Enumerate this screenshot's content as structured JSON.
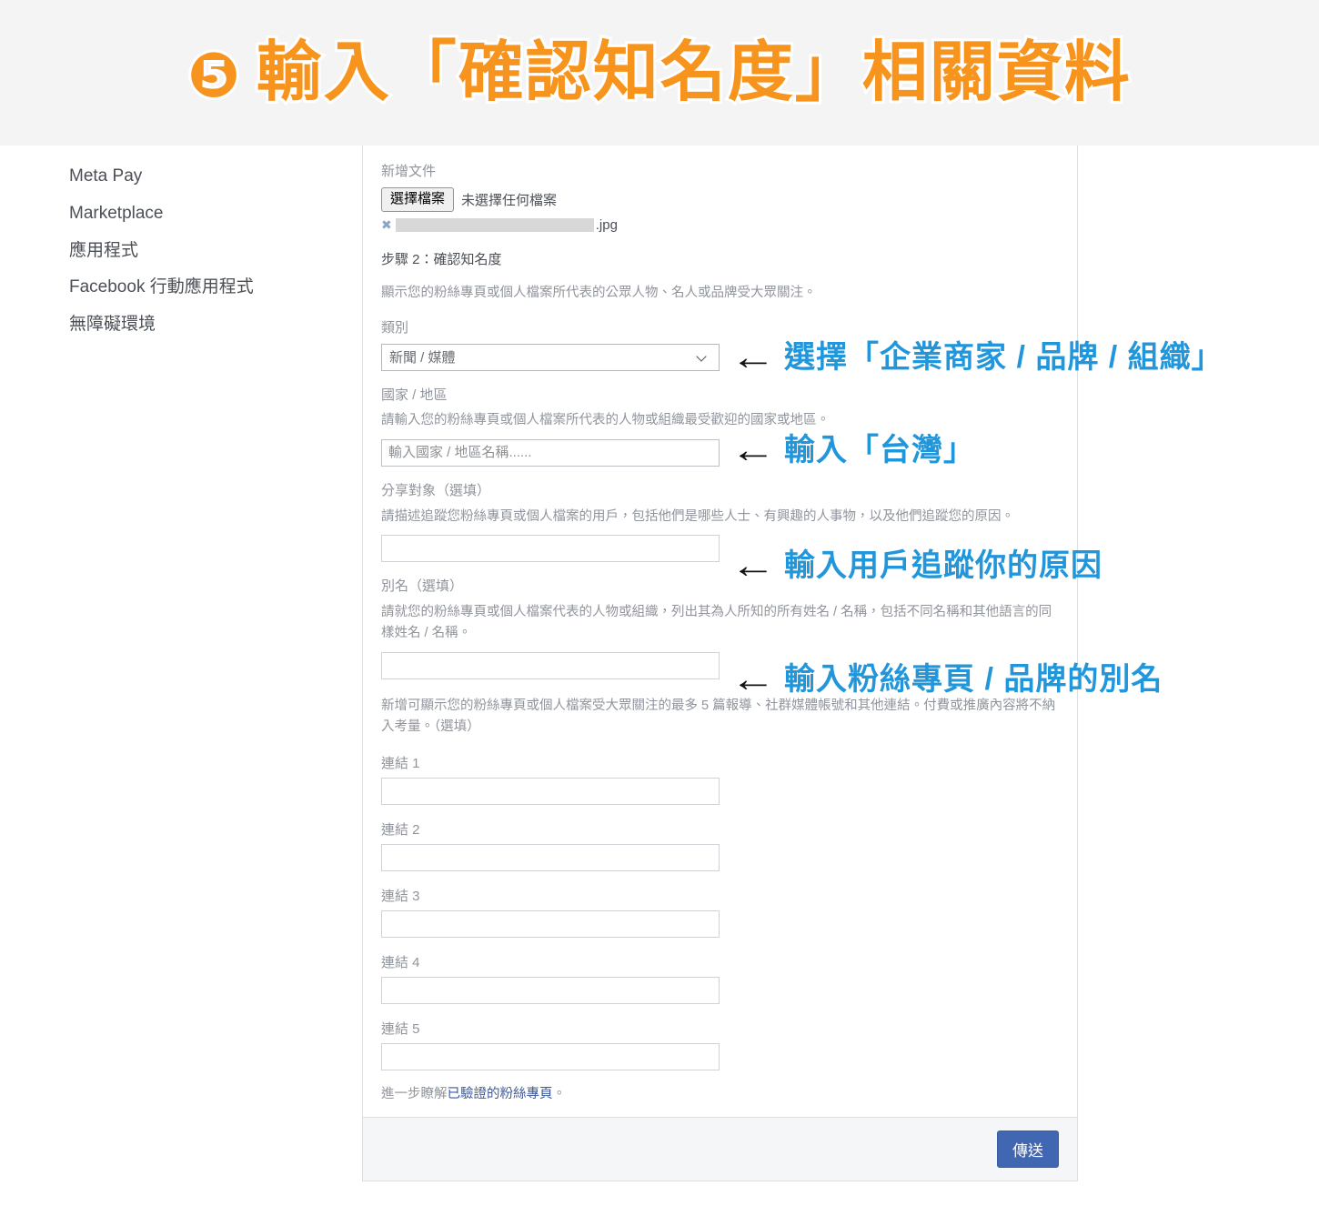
{
  "banner": {
    "step_badge": "❺",
    "title": "輸入「確認知名度」相關資料",
    "color": "#f7941e"
  },
  "sidebar": {
    "items": [
      {
        "label": "Meta Pay"
      },
      {
        "label": "Marketplace"
      },
      {
        "label": "應用程式"
      },
      {
        "label": "Facebook 行動應用程式"
      },
      {
        "label": "無障礙環境"
      }
    ]
  },
  "form": {
    "add_document_label": "新增文件",
    "file_button_label": "選擇檔案",
    "file_status_text": "未選擇任何檔案",
    "attachment_remove_icon": "✖",
    "attachment_extension": ".jpg",
    "step_title": "步驟 2：確認知名度",
    "step_description": "顯示您的粉絲專頁或個人檔案所代表的公眾人物、名人或品牌受大眾關注。",
    "category": {
      "label": "類別",
      "selected_value": "新聞 / 媒體"
    },
    "country": {
      "label": "國家 / 地區",
      "description": "請輸入您的粉絲專頁或個人檔案所代表的人物或組織最受歡迎的國家或地區。",
      "placeholder": "輸入國家 / 地區名稱......",
      "value": ""
    },
    "audience": {
      "label": "分享對象（選填）",
      "description": "請描述追蹤您粉絲專頁或個人檔案的用戶，包括他們是哪些人士、有興趣的人事物，以及他們追蹤您的原因。",
      "value": ""
    },
    "alias": {
      "label": "別名（選填）",
      "description": "請就您的粉絲專頁或個人檔案代表的人物或組織，列出其為人所知的所有姓名 / 名稱，包括不同名稱和其他語言的同樣姓名 / 名稱。",
      "value": ""
    },
    "links_description": "新增可顯示您的粉絲專頁或個人檔案受大眾關注的最多 5 篇報導、社群媒體帳號和其他連結。付費或推廣內容將不納入考量。（選填）",
    "links": [
      {
        "label": "連結 1",
        "value": ""
      },
      {
        "label": "連結 2",
        "value": ""
      },
      {
        "label": "連結 3",
        "value": ""
      },
      {
        "label": "連結 4",
        "value": ""
      },
      {
        "label": "連結 5",
        "value": ""
      }
    ],
    "footnote_prefix": "進一步瞭解",
    "footnote_link": "已驗證的粉絲專頁",
    "footnote_suffix": "。",
    "submit_label": "傳送"
  },
  "annotations": {
    "arrow_glyph": "←",
    "color": "#2196da",
    "items": [
      {
        "text": "選擇「企業商家 / 品牌 / 組織」"
      },
      {
        "text": "輸入「台灣」"
      },
      {
        "text": "輸入用戶追蹤你的原因"
      },
      {
        "text": "輸入粉絲專頁 / 品牌的別名"
      }
    ]
  }
}
